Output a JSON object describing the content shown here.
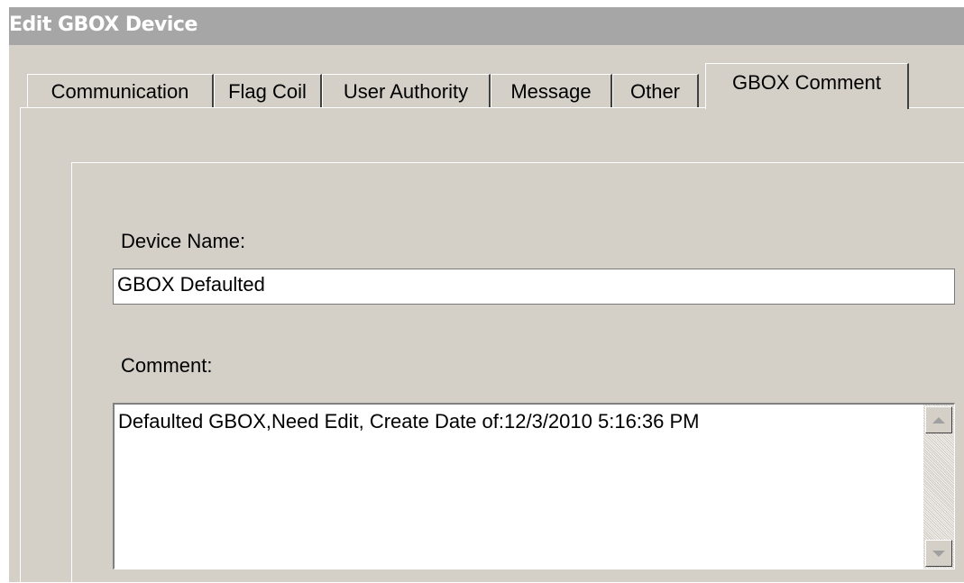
{
  "window": {
    "title": "Edit GBOX Device"
  },
  "tabs": [
    {
      "label": "Communication"
    },
    {
      "label": "Flag Coil"
    },
    {
      "label": "User Authority"
    },
    {
      "label": "Message"
    },
    {
      "label": "Other"
    },
    {
      "label": "GBOX Comment",
      "active": true
    }
  ],
  "form": {
    "device_name_label": "Device Name:",
    "device_name_value": "GBOX Defaulted",
    "comment_label": "Comment:",
    "comment_value": "Defaulted GBOX,Need Edit, Create Date of:12/3/2010 5:16:36 PM"
  },
  "scrollbar": {
    "up_icon": "arrow-up-icon",
    "down_icon": "arrow-down-icon"
  },
  "colors": {
    "dialog_bg": "#d4d0c8",
    "titlebar_bg": "#a6a6a6",
    "title_text": "#ffffff"
  }
}
